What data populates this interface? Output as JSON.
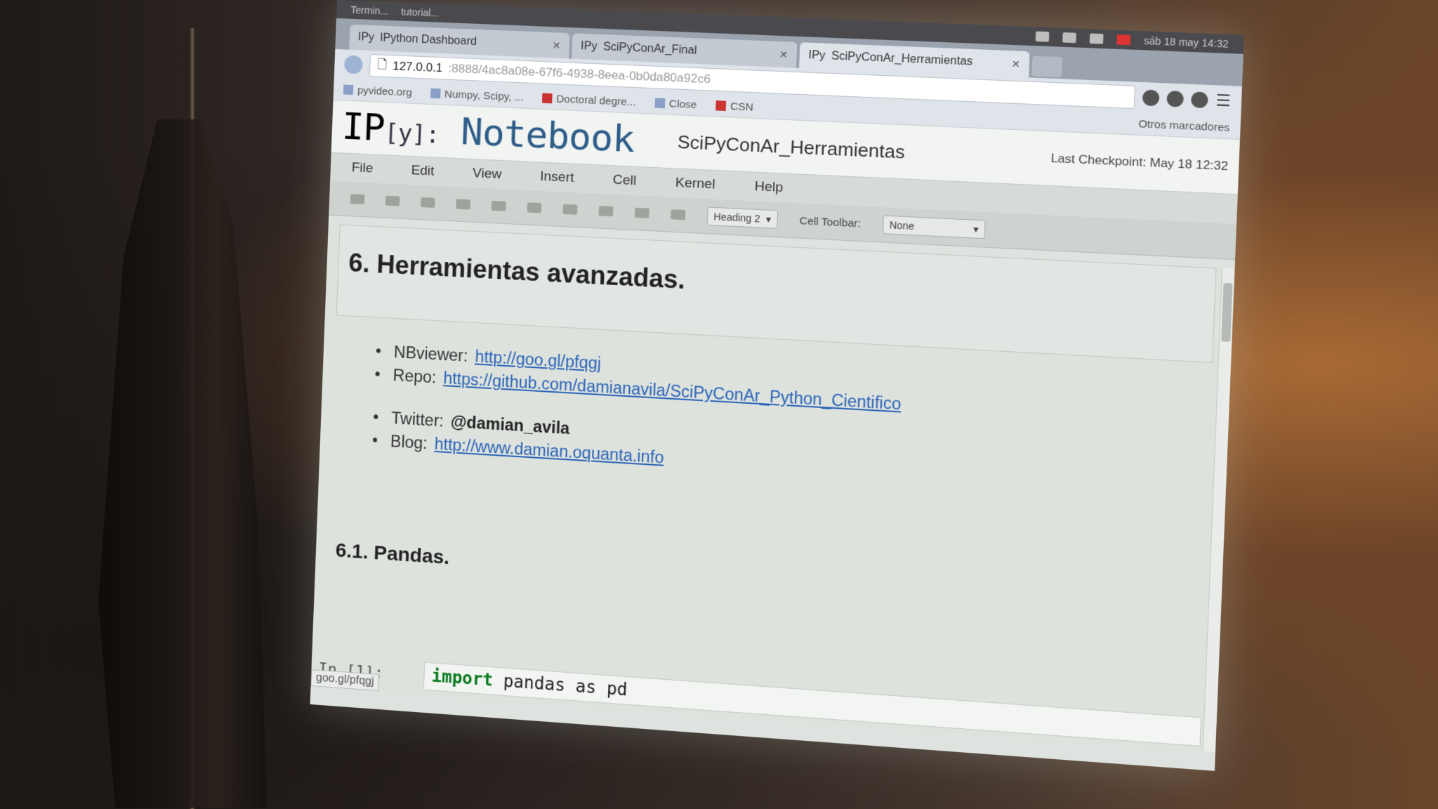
{
  "system_bar": {
    "items": [
      "Termin...",
      "tutorial..."
    ],
    "clock": "sáb 18 may 14:32"
  },
  "tabs": [
    {
      "label": "IPython Dashboard",
      "icon": "ipython-tab-icon"
    },
    {
      "label": "SciPyConAr_Final",
      "icon": "ipython-tab-icon"
    },
    {
      "label": "SciPyConAr_Herramientas",
      "icon": "ipython-tab-icon"
    }
  ],
  "address": {
    "host": "127.0.0.1",
    "path": ":8888/4ac8a08e-67f6-4938-8eea-0b0da80a92c6"
  },
  "bookmarks": [
    {
      "label": "pyvideo.org"
    },
    {
      "label": "Numpy, Scipy, ..."
    },
    {
      "label": "Doctoral degre..."
    },
    {
      "label": "Close"
    },
    {
      "label": "CSN"
    }
  ],
  "bookmarks_other": "Otros marcadores",
  "notebook": {
    "logo_ip": "IP",
    "logo_y": "[y]:",
    "logo_nb": "Notebook",
    "name": "SciPyConAr_Herramientas",
    "checkpoint": "Last Checkpoint: May 18 12:32"
  },
  "menu": [
    "File",
    "Edit",
    "View",
    "Insert",
    "Cell",
    "Kernel",
    "Help"
  ],
  "toolbar": {
    "cell_type": "Heading 2",
    "cell_toolbar_label": "Cell Toolbar:",
    "cell_toolbar_value": "None"
  },
  "content": {
    "heading": "6. Herramientas avanzadas.",
    "nbviewer_label": "NBviewer:",
    "nbviewer_link": "http://goo.gl/pfqgj",
    "repo_label": "Repo:",
    "repo_link": "https://github.com/damianavila/SciPyConAr_Python_Cientifico",
    "twitter_label": "Twitter:",
    "twitter_handle": "@damian_avila",
    "blog_label": "Blog:",
    "blog_link": "http://www.damian.oquanta.info",
    "subheading": "6.1. Pandas.",
    "prompt": "In [1]:",
    "code_kw": "import",
    "code_rest": " pandas as pd"
  },
  "statusbar": "goo.gl/pfqgj"
}
